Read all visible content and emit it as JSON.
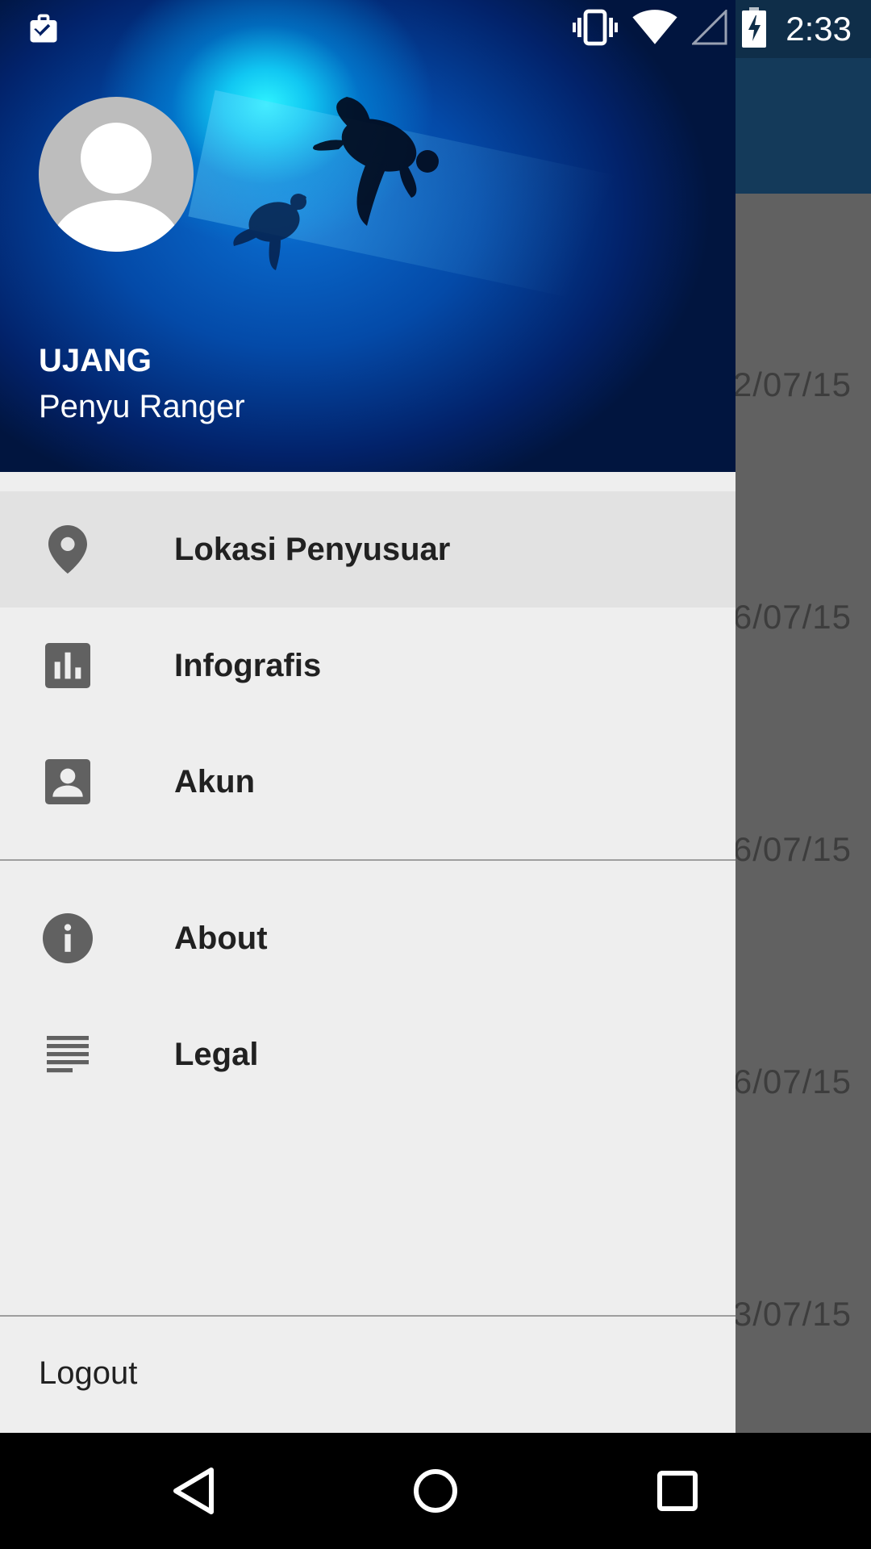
{
  "status_bar": {
    "time": "2:33",
    "icons": [
      "task-check-icon",
      "vibrate-icon",
      "wifi-icon",
      "cell-signal-icon",
      "battery-charging-icon"
    ]
  },
  "background": {
    "dates": [
      "2/07/15",
      "6/07/15",
      "6/07/15",
      "6/07/15",
      "3/07/15"
    ]
  },
  "drawer": {
    "user": {
      "name": "UJANG",
      "role": "Penyu Ranger"
    },
    "menu_primary": [
      {
        "label": "Lokasi Penyusuar",
        "icon": "location-pin-icon",
        "active": true
      },
      {
        "label": "Infografis",
        "icon": "bar-chart-icon",
        "active": false
      },
      {
        "label": "Akun",
        "icon": "account-box-icon",
        "active": false
      }
    ],
    "menu_secondary": [
      {
        "label": "About",
        "icon": "info-icon"
      },
      {
        "label": "Legal",
        "icon": "text-lines-icon"
      }
    ],
    "logout_label": "Logout"
  },
  "navbar": {
    "buttons": [
      "back-icon",
      "home-icon",
      "recents-icon"
    ]
  },
  "colors": {
    "drawer_bg": "#eeeeee",
    "active_item_bg": "#e2e2e2",
    "appbar": "#143a5a",
    "scrim_content": "#616161"
  }
}
